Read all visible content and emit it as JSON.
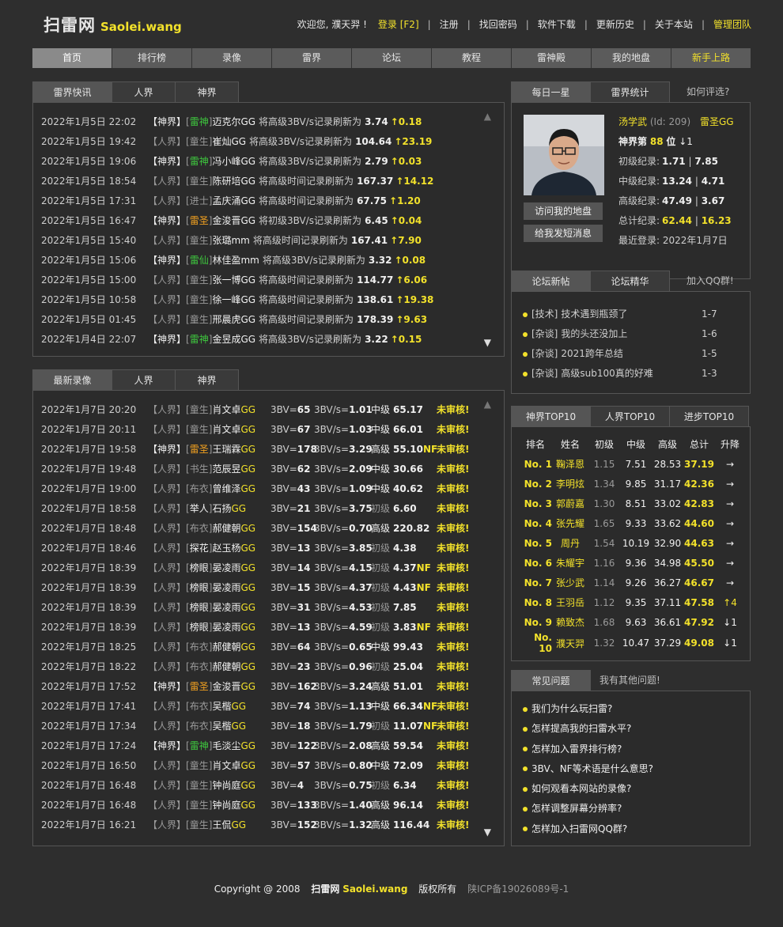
{
  "logo": {
    "cn": "扫雷网",
    "en": "Saolei.wang"
  },
  "topnav": {
    "welcome": "欢迎您, 濮天羿 !",
    "links": [
      "登录 [F2]",
      "注册",
      "找回密码",
      "软件下载",
      "更新历史",
      "关于本站",
      "管理团队"
    ]
  },
  "mainnav": [
    "首页",
    "排行榜",
    "录像",
    "雷界",
    "论坛",
    "教程",
    "雷神殿",
    "我的地盘",
    "新手上路"
  ],
  "news": {
    "tabs": [
      "雷界快讯",
      "人界",
      "神界"
    ],
    "rows": [
      [
        "2022年1月5日 22:02",
        "神界",
        "雷神",
        "迈克尔GG",
        "将高级3BV/s记录刷新为",
        "3.74",
        "↑0.18"
      ],
      [
        "2022年1月5日 19:42",
        "人界",
        "童生",
        "崔灿GG",
        "将高级3BV/s记录刷新为",
        "104.64",
        "↑23.19"
      ],
      [
        "2022年1月5日 19:06",
        "神界",
        "雷神",
        "冯小峰GG",
        "将高级3BV/s记录刷新为",
        "2.79",
        "↑0.03"
      ],
      [
        "2022年1月5日 18:54",
        "人界",
        "童生",
        "陈研培GG",
        "将高级时间记录刷新为",
        "167.37",
        "↑14.12"
      ],
      [
        "2022年1月5日 17:31",
        "人界",
        "进士",
        "孟庆涌GG",
        "将高级时间记录刷新为",
        "67.75",
        "↑1.20"
      ],
      [
        "2022年1月5日 16:47",
        "神界",
        "雷圣",
        "金浚晋GG",
        "将初级3BV/s记录刷新为",
        "6.45",
        "↑0.04"
      ],
      [
        "2022年1月5日 15:40",
        "人界",
        "童生",
        "张璐mm",
        "将高级时间记录刷新为",
        "167.41",
        "↑7.90"
      ],
      [
        "2022年1月5日 15:06",
        "神界",
        "雷仙",
        "林佳盈mm",
        "将高级3BV/s记录刷新为",
        "3.32",
        "↑0.08"
      ],
      [
        "2022年1月5日 15:00",
        "人界",
        "童生",
        "张一博GG",
        "将高级时间记录刷新为",
        "114.77",
        "↑6.06"
      ],
      [
        "2022年1月5日 10:58",
        "人界",
        "童生",
        "徐一峰GG",
        "将高级时间记录刷新为",
        "138.61",
        "↑19.38"
      ],
      [
        "2022年1月5日 01:45",
        "人界",
        "童生",
        "邢晨虎GG",
        "将高级时间记录刷新为",
        "178.39",
        "↑9.63"
      ],
      [
        "2022年1月4日 22:07",
        "神界",
        "雷神",
        "金昱成GG",
        "将高级3BV/s记录刷新为",
        "3.22",
        "↑0.15"
      ]
    ]
  },
  "videos": {
    "tabs": [
      "最新录像",
      "人界",
      "神界"
    ],
    "rows": [
      [
        "2022年1月7日 20:20",
        "人界",
        "童生",
        "肖文卓GG",
        "65",
        "1.01",
        "中级",
        "65.17",
        "",
        "未审核!"
      ],
      [
        "2022年1月7日 20:11",
        "人界",
        "童生",
        "肖文卓GG",
        "67",
        "1.03",
        "中级",
        "66.01",
        "",
        "未审核!"
      ],
      [
        "2022年1月7日 19:58",
        "神界",
        "雷圣",
        "王瑞霖GG",
        "178",
        "3.29",
        "高级",
        "55.10",
        "NF",
        "未审核!"
      ],
      [
        "2022年1月7日 19:48",
        "人界",
        "书生",
        "范辰昱GG",
        "62",
        "2.09",
        "中级",
        "30.66",
        "",
        "未审核!"
      ],
      [
        "2022年1月7日 19:00",
        "人界",
        "布衣",
        "曾维泽GG",
        "43",
        "1.09",
        "中级",
        "40.62",
        "",
        "未审核!"
      ],
      [
        "2022年1月7日 18:58",
        "人界",
        "举人",
        "石扬GG",
        "21",
        "3.75",
        "初级",
        "6.60",
        "",
        "未审核!"
      ],
      [
        "2022年1月7日 18:48",
        "人界",
        "布衣",
        "郝健朝GG",
        "154",
        "0.70",
        "高级",
        "220.82",
        "",
        "未审核!"
      ],
      [
        "2022年1月7日 18:46",
        "人界",
        "探花",
        "赵玉杨GG",
        "13",
        "3.85",
        "初级",
        "4.38",
        "",
        "未审核!"
      ],
      [
        "2022年1月7日 18:39",
        "人界",
        "榜眼",
        "晏凌雨GG",
        "14",
        "4.15",
        "初级",
        "4.37",
        "NF",
        "未审核!"
      ],
      [
        "2022年1月7日 18:39",
        "人界",
        "榜眼",
        "晏凌雨GG",
        "15",
        "4.37",
        "初级",
        "4.43",
        "NF",
        "未审核!"
      ],
      [
        "2022年1月7日 18:39",
        "人界",
        "榜眼",
        "晏凌雨GG",
        "31",
        "4.53",
        "初级",
        "7.85",
        "",
        "未审核!"
      ],
      [
        "2022年1月7日 18:39",
        "人界",
        "榜眼",
        "晏凌雨GG",
        "13",
        "4.59",
        "初级",
        "3.83",
        "NF",
        "未审核!"
      ],
      [
        "2022年1月7日 18:25",
        "人界",
        "布衣",
        "郝健朝GG",
        "64",
        "0.65",
        "中级",
        "99.43",
        "",
        "未审核!"
      ],
      [
        "2022年1月7日 18:22",
        "人界",
        "布衣",
        "郝健朝GG",
        "23",
        "0.96",
        "初级",
        "25.04",
        "",
        "未审核!"
      ],
      [
        "2022年1月7日 17:52",
        "神界",
        "雷圣",
        "金浚晋GG",
        "162",
        "3.24",
        "高级",
        "51.01",
        "",
        "未审核!"
      ],
      [
        "2022年1月7日 17:41",
        "人界",
        "布衣",
        "吴楷GG",
        "74",
        "1.13",
        "中级",
        "66.34",
        "NF",
        "未审核!"
      ],
      [
        "2022年1月7日 17:34",
        "人界",
        "布衣",
        "吴楷GG",
        "18",
        "1.79",
        "初级",
        "11.07",
        "NF",
        "未审核!"
      ],
      [
        "2022年1月7日 17:24",
        "神界",
        "雷神",
        "毛淡尘GG",
        "122",
        "2.08",
        "高级",
        "59.54",
        "",
        "未审核!"
      ],
      [
        "2022年1月7日 16:50",
        "人界",
        "童生",
        "肖文卓GG",
        "57",
        "0.80",
        "中级",
        "72.09",
        "",
        "未审核!"
      ],
      [
        "2022年1月7日 16:48",
        "人界",
        "童生",
        "钟尚庭GG",
        "4",
        "0.75",
        "初级",
        "6.34",
        "",
        "未审核!"
      ],
      [
        "2022年1月7日 16:48",
        "人界",
        "童生",
        "钟尚庭GG",
        "133",
        "1.40",
        "高级",
        "96.14",
        "",
        "未审核!"
      ],
      [
        "2022年1月7日 16:21",
        "人界",
        "童生",
        "王侃GG",
        "152",
        "1.32",
        "高级",
        "116.44",
        "",
        "未审核!"
      ]
    ]
  },
  "star": {
    "tabs": [
      "每日一星",
      "雷界统计"
    ],
    "ext": "如何评选?",
    "name": "汤学武",
    "id": "(Id: 209)",
    "title": "雷圣GG",
    "rank_prefix": "神界第",
    "rank": "88",
    "rank_suffix": "位",
    "rank_change": "↓1",
    "stats": [
      [
        "初级纪录:",
        "1.71",
        "7.85"
      ],
      [
        "中级纪录:",
        "13.24",
        "4.71"
      ],
      [
        "高级纪录:",
        "47.49",
        "3.67"
      ],
      [
        "总计纪录:",
        "62.44",
        "16.23"
      ]
    ],
    "last_login_label": "最近登录:",
    "last_login": "2022年1月7日",
    "btn_visit": "访问我的地盘",
    "btn_msg": "给我发短消息"
  },
  "forum": {
    "tabs": [
      "论坛新帖",
      "论坛精华"
    ],
    "ext": "加入QQ群!",
    "rows": [
      [
        "[技术]",
        "技术遇到瓶颈了",
        "1-7"
      ],
      [
        "[杂谈]",
        "我的头还没加上",
        "1-6"
      ],
      [
        "[杂谈]",
        "2021跨年总结",
        "1-5"
      ],
      [
        "[杂谈]",
        "高级sub100真的好难",
        "1-3"
      ]
    ]
  },
  "top10": {
    "tabs": [
      "神界TOP10",
      "人界TOP10",
      "进步TOP10"
    ],
    "headers": [
      "排名",
      "姓名",
      "初级",
      "中级",
      "高级",
      "总计",
      "升降"
    ],
    "rows": [
      [
        "No. 1",
        "鞠泽恩",
        "1.15",
        "7.51",
        "28.53",
        "37.19",
        "→"
      ],
      [
        "No. 2",
        "李明炫",
        "1.34",
        "9.85",
        "31.17",
        "42.36",
        "→"
      ],
      [
        "No. 3",
        "郭蔚嘉",
        "1.30",
        "8.51",
        "33.02",
        "42.83",
        "→"
      ],
      [
        "No. 4",
        "张先耀",
        "1.65",
        "9.33",
        "33.62",
        "44.60",
        "→"
      ],
      [
        "No. 5",
        "周丹",
        "1.54",
        "10.19",
        "32.90",
        "44.63",
        "→"
      ],
      [
        "No. 6",
        "朱耀宇",
        "1.16",
        "9.36",
        "34.98",
        "45.50",
        "→"
      ],
      [
        "No. 7",
        "张少武",
        "1.14",
        "9.26",
        "36.27",
        "46.67",
        "→"
      ],
      [
        "No. 8",
        "王羽岳",
        "1.12",
        "9.35",
        "37.11",
        "47.58",
        "↑4"
      ],
      [
        "No. 9",
        "赖致杰",
        "1.68",
        "9.63",
        "36.61",
        "47.92",
        "↓1"
      ],
      [
        "No. 10",
        "濮天羿",
        "1.32",
        "10.47",
        "37.29",
        "49.08",
        "↓1"
      ]
    ]
  },
  "faq": {
    "tabs": [
      "常见问题"
    ],
    "ext": "我有其他问题!",
    "rows": [
      "我们为什么玩扫雷?",
      "怎样提高我的扫雷水平?",
      "怎样加入雷界排行榜?",
      "3BV、NF等术语是什么意思?",
      "如何观看本网站的录像?",
      "怎样调整屏幕分辨率?",
      "怎样加入扫雷网QQ群?"
    ]
  },
  "footer": {
    "copy": "Copyright @ 2008",
    "site_cn": "扫雷网",
    "site_en": "Saolei.wang",
    "rights": "版权所有",
    "icp": "陕ICP备19026089号-1"
  },
  "labels": {
    "bv": "3BV=",
    "bvs": "3BV/s="
  }
}
